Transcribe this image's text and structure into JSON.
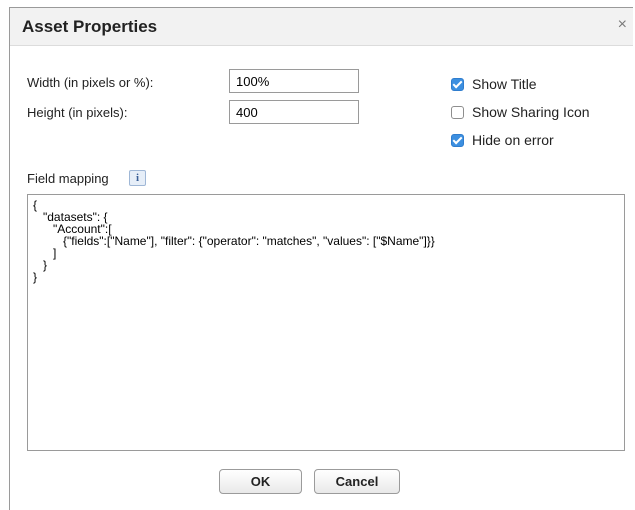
{
  "dialog": {
    "title": "Asset Properties",
    "close_symbol": "×"
  },
  "form": {
    "width_label": "Width (in pixels or %):",
    "width_value": "100%",
    "height_label": "Height (in pixels):",
    "height_value": "400"
  },
  "options": [
    {
      "label": "Show Title",
      "checked": true
    },
    {
      "label": "Show Sharing Icon",
      "checked": false
    },
    {
      "label": "Hide on error",
      "checked": true
    }
  ],
  "mapping": {
    "label": "Field mapping",
    "info_glyph": "i",
    "json_text": "{\n   \"datasets\": {\n      \"Account\":[\n         {\"fields\":[\"Name\"], \"filter\": {\"operator\": \"matches\", \"values\": [\"$Name\"]}}\n      ]\n   }\n}"
  },
  "buttons": {
    "ok": "OK",
    "cancel": "Cancel"
  },
  "colors": {
    "checkbox_checked": "#3c8fe0",
    "titlebar_bg": "#f2f2f2"
  },
  "icons": {
    "close": "close-icon",
    "info": "info-icon",
    "checkbox_checked": "checkmark-icon"
  }
}
